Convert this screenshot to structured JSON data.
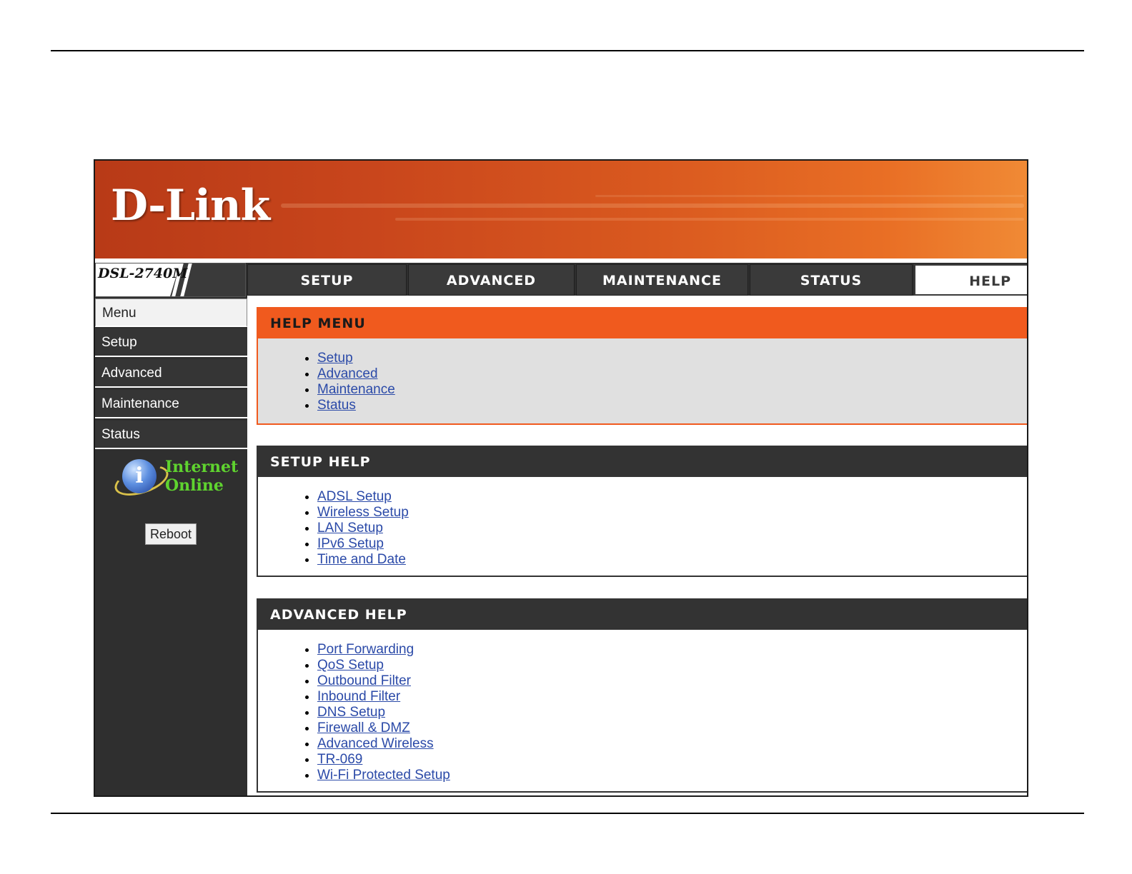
{
  "brand": {
    "logo_text": "D-Link",
    "model": "DSL-2740M"
  },
  "nav_tabs": [
    {
      "label": "SETUP"
    },
    {
      "label": "ADVANCED"
    },
    {
      "label": "MAINTENANCE"
    },
    {
      "label": "STATUS"
    },
    {
      "label": "HELP",
      "active": true
    }
  ],
  "sidebar": {
    "items": [
      {
        "label": "Menu"
      },
      {
        "label": "Setup"
      },
      {
        "label": "Advanced"
      },
      {
        "label": "Maintenance"
      },
      {
        "label": "Status"
      }
    ],
    "status_line1": "Internet",
    "status_line2": "Online",
    "status_icon": "globe-info-icon",
    "reboot_label": "Reboot"
  },
  "help_menu": {
    "title": "HELP MENU",
    "links": [
      "Setup",
      "Advanced",
      "Maintenance",
      "Status"
    ]
  },
  "setup_help": {
    "title": "SETUP HELP",
    "links": [
      "ADSL Setup",
      "Wireless Setup",
      "LAN Setup",
      "IPv6 Setup",
      "Time and Date"
    ]
  },
  "advanced_help": {
    "title": "ADVANCED HELP",
    "links": [
      "Port Forwarding",
      "QoS Setup",
      "Outbound Filter",
      "Inbound Filter",
      "DNS Setup",
      "Firewall & DMZ",
      "Advanced Wireless",
      "TR-069",
      "Wi-Fi Protected Setup"
    ]
  },
  "colors": {
    "accent_orange": "#f05a1e",
    "nav_dark": "#3a3a3a",
    "link_blue": "#2b4aa8",
    "online_green": "#5fd32f"
  }
}
